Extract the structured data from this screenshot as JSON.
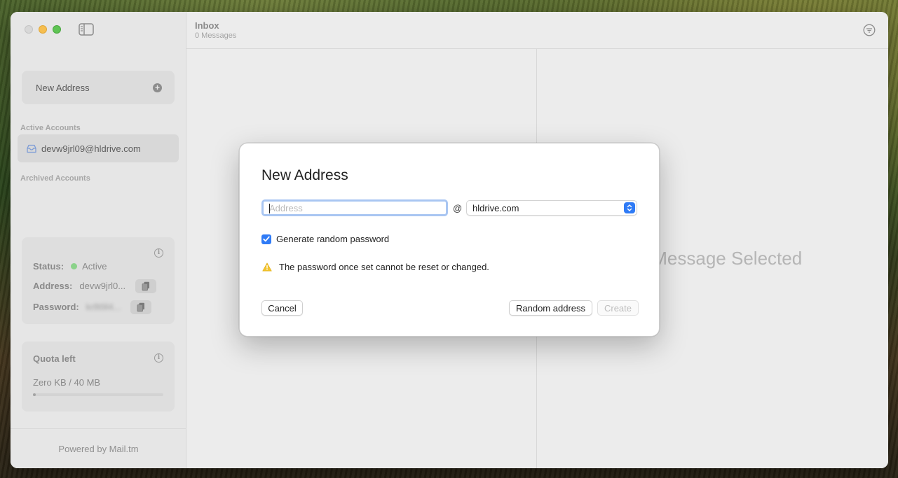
{
  "window": {
    "toolbar": {
      "title": "Inbox",
      "subtitle": "0 Messages"
    },
    "detail": {
      "placeholder": "No Message Selected"
    }
  },
  "sidebar": {
    "new_address_label": "New Address",
    "active_accounts_label": "Active Accounts",
    "archived_accounts_label": "Archived Accounts",
    "accounts": [
      {
        "email": "devw9jrl09@hldrive.com"
      }
    ],
    "account_card": {
      "status_key": "Status:",
      "status_value": "Active",
      "address_key": "Address:",
      "address_value": "devw9jrl0...",
      "password_key": "Password:",
      "password_value": "kr8t9l4..."
    },
    "quota_card": {
      "title": "Quota left",
      "value": "Zero KB / 40 MB",
      "used_fraction": 0.0
    },
    "footer": "Powered by Mail.tm"
  },
  "dialog": {
    "title": "New Address",
    "address_placeholder": "Address",
    "address_value": "",
    "at": "@",
    "domain_selected": "hldrive.com",
    "generate_password_label": "Generate random password",
    "generate_password_checked": true,
    "warning_text": "The password once set cannot be reset or changed.",
    "cancel_label": "Cancel",
    "random_address_label": "Random address",
    "create_label": "Create"
  },
  "colors": {
    "accent": "#2f7bf6",
    "status_active": "#8bd28a",
    "warning": "#f3c42e"
  }
}
